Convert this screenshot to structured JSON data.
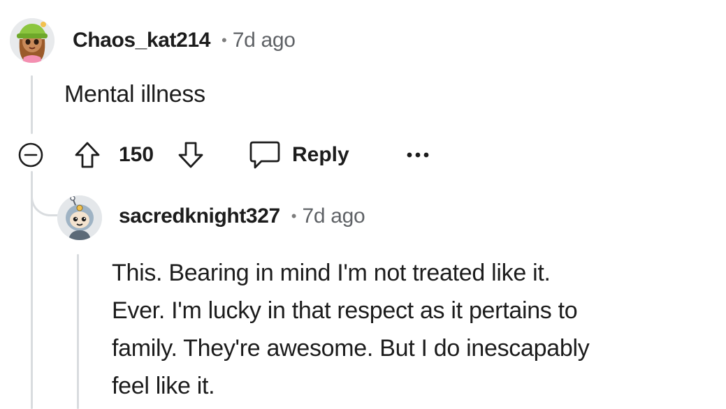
{
  "comments": [
    {
      "username": "Chaos_kat214",
      "separator": "•",
      "time": "7d ago",
      "body": "Mental illness",
      "actions": {
        "score": "150",
        "reply_label": "Reply",
        "more_label": "•••"
      }
    },
    {
      "username": "sacredknight327",
      "separator": "•",
      "time": "7d ago",
      "body_lines": [
        "This. Bearing in mind I'm not treated like it.",
        "Ever. I'm lucky in that respect as it pertains to",
        "family. They're awesome. But I do inescapably",
        "feel like it."
      ]
    }
  ],
  "colors": {
    "text": "#1c1c1c",
    "muted": "#5f6266",
    "thread_line": "#d9dcdf"
  },
  "icons": {
    "collapse": "collapse-minus-icon",
    "upvote": "arrow-up-icon",
    "downvote": "arrow-down-icon",
    "reply": "speech-bubble-icon",
    "more": "ellipsis-icon"
  }
}
